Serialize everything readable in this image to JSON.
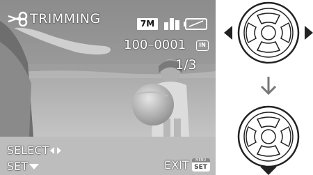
{
  "screen": {
    "title": "TRIMMING",
    "resolution_badge": "7M",
    "file_number": "100–0001",
    "file_number_icon_text": "IN",
    "page_indicator": "1/3",
    "icons": {
      "mode": "scissors-icon",
      "quality": "quality-icon",
      "battery": "battery-icon",
      "file_type": "internal-memory-icon"
    }
  },
  "menu": {
    "select_label": "SELECT",
    "set_label": "SET",
    "exit_label": "EXIT",
    "exit_key_top": "MENU",
    "exit_key_bottom": "SET"
  },
  "diagram": {
    "top_dial_icon": "cursor-pad-left-right-icon",
    "down_arrow_icon": "arrow-down-icon",
    "bottom_dial_icon": "cursor-pad-down-icon"
  },
  "colors": {
    "osd_text": "#ffffff",
    "menu_bar": "#bdbdbd",
    "diagram_ink": "#222222"
  }
}
